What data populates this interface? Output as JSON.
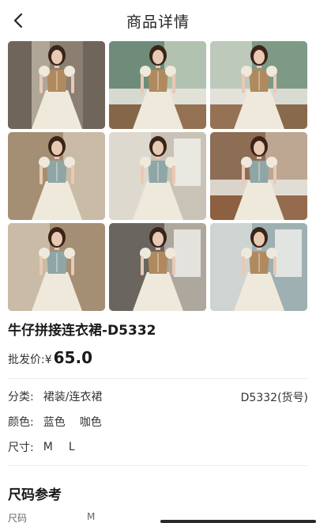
{
  "header": {
    "title": "商品详情",
    "back_icon": "chevron-left-icon"
  },
  "gallery": {
    "images": [
      {
        "alt": "model-brown-corset-dress"
      },
      {
        "alt": "model-brown-corset-dress-kitchen"
      },
      {
        "alt": "model-brown-corset-dress-kitchen-2"
      },
      {
        "alt": "model-blue-corset-dress"
      },
      {
        "alt": "model-blue-corset-dress-window"
      },
      {
        "alt": "model-blue-corset-dress-kitchen"
      },
      {
        "alt": "model-blue-corset-dress-2"
      },
      {
        "alt": "model-brown-corset-dress-window"
      },
      {
        "alt": "model-brown-corset-dress-3"
      }
    ]
  },
  "product": {
    "title": "牛仔拼接连衣裙-D5332",
    "price_label": "批发价:",
    "price_symbol": "¥",
    "price_value": "65.0"
  },
  "info": {
    "category_label": "分类:",
    "category_value": "裙装/连衣裙",
    "sku": "D5332(货号)",
    "color_label": "颜色:",
    "colors": [
      "蓝色",
      "咖色"
    ],
    "size_label": "尺寸:",
    "sizes": [
      "M",
      "L"
    ]
  },
  "size_reference": {
    "title": "尺码参考",
    "header_col1": "尺码",
    "header_col2": "M"
  },
  "palette": {
    "brown": "#b08a5e",
    "blue": "#8fa6a6",
    "cream": "#efe9dc",
    "skin": "#e8c9b4",
    "hair": "#3a2418"
  }
}
